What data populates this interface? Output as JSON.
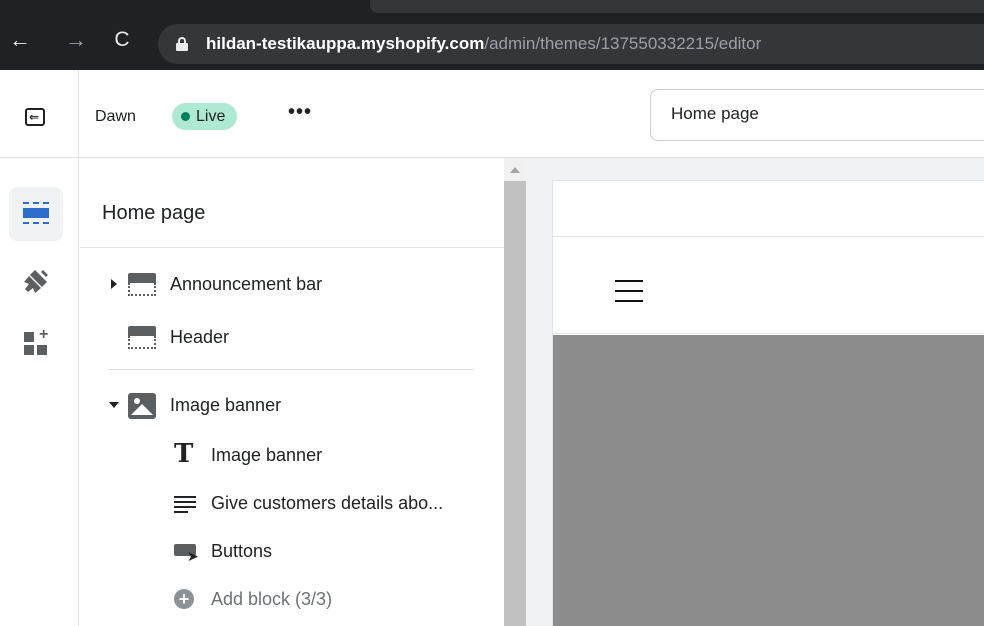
{
  "browser": {
    "url_host": "hildan-testikauppa.myshopify.com",
    "url_path": "/admin/themes/137550332215/editor",
    "back_glyph": "←",
    "forward_glyph": "→",
    "reload_glyph": "C"
  },
  "topbar": {
    "theme_name": "Dawn",
    "live_label": "Live",
    "more_label": "•••",
    "page_select_value": "Home page"
  },
  "rail": {
    "items": [
      {
        "name": "sections",
        "icon": "sections-icon",
        "active": true
      },
      {
        "name": "theme-settings",
        "icon": "paint-brush-icon",
        "active": false
      },
      {
        "name": "app-embeds",
        "icon": "apps-add-icon",
        "active": false
      }
    ]
  },
  "sidebar": {
    "title": "Home page",
    "sections": [
      {
        "label": "Announcement bar",
        "icon": "section-block-icon",
        "caret": "collapsed"
      },
      {
        "label": "Header",
        "icon": "section-block-icon",
        "caret": "none"
      },
      {
        "label": "Image banner",
        "icon": "image-icon",
        "caret": "expanded",
        "blocks": [
          {
            "label": "Image banner",
            "icon": "text-heading-icon"
          },
          {
            "label": "Give customers details abo...",
            "icon": "text-paragraph-icon"
          },
          {
            "label": "Buttons",
            "icon": "buttons-icon"
          }
        ],
        "add_block_label": "Add block (3/3)"
      }
    ]
  },
  "colors": {
    "accent": "#2c6ecb",
    "live_badge_bg": "#aee9d1",
    "live_dot": "#007f5f",
    "browser_bg": "#202124",
    "banner_placeholder": "#8c8c8c"
  }
}
